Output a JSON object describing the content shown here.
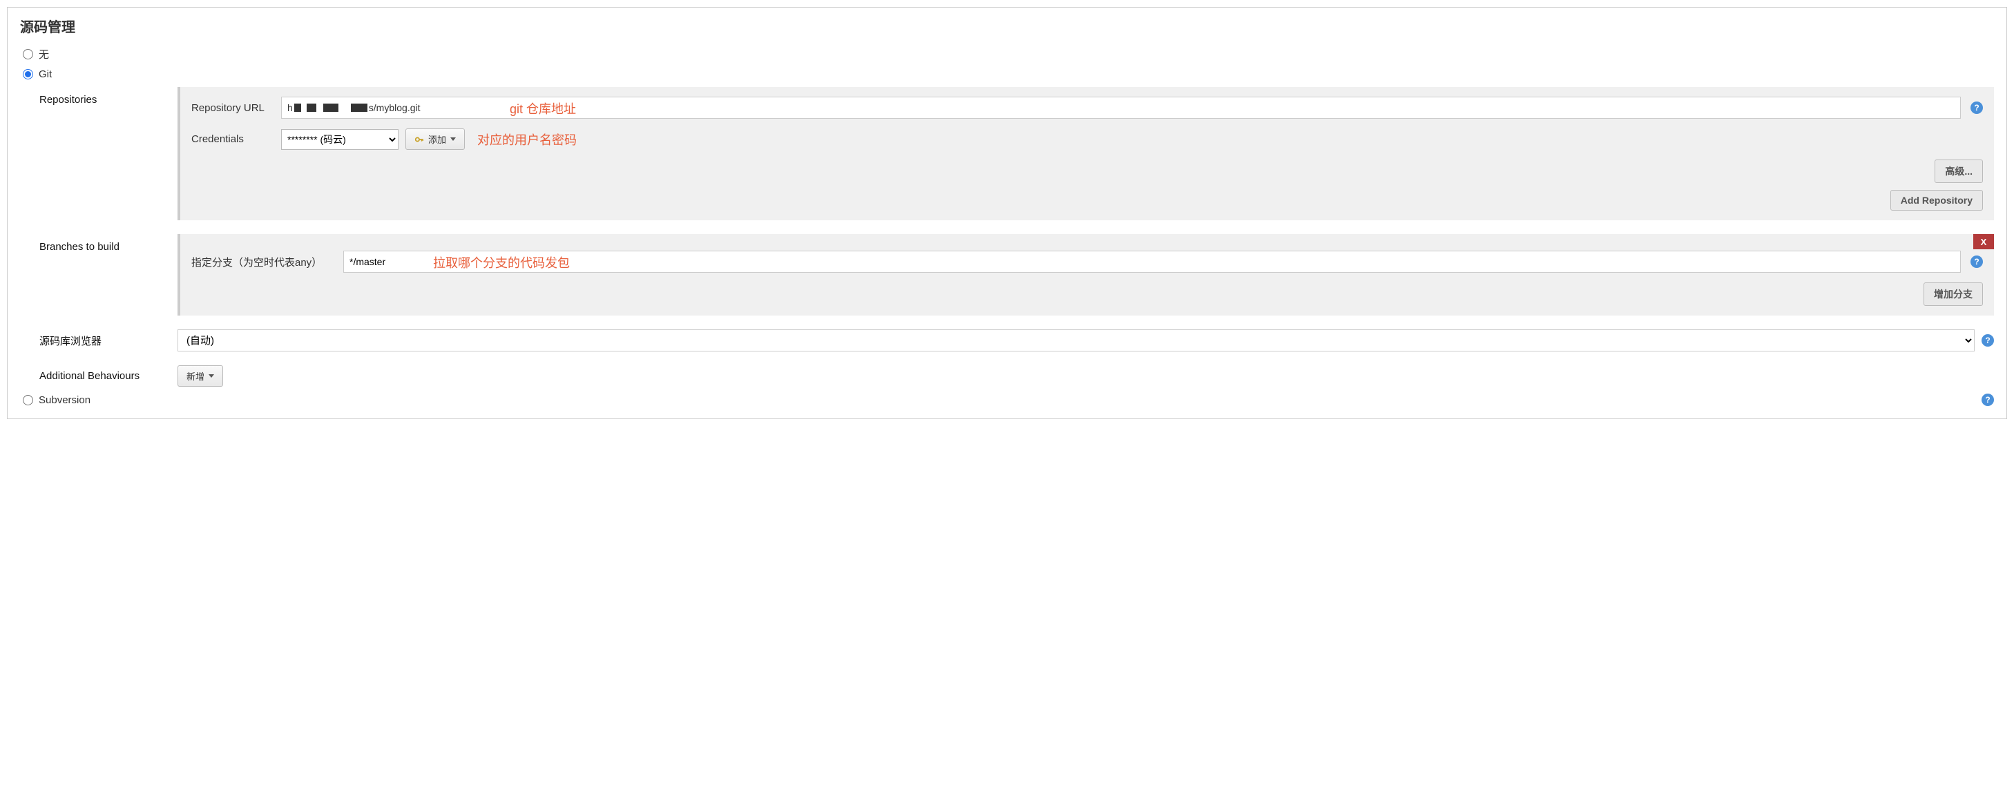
{
  "section": {
    "title": "源码管理"
  },
  "scm_options": {
    "none": {
      "label": "无",
      "selected": false
    },
    "git": {
      "label": "Git",
      "selected": true
    },
    "subversion": {
      "label": "Subversion",
      "selected": false
    }
  },
  "repositories": {
    "label": "Repositories",
    "url_label": "Repository URL",
    "url_prefix": "h",
    "url_suffix": "s/myblog.git",
    "annotation": "git 仓库地址",
    "credentials_label": "Credentials",
    "credentials_value": "******** (码云)",
    "add_button": "添加",
    "cred_annotation": "对应的用户名密码",
    "advanced_button": "高级...",
    "add_repo_button": "Add Repository"
  },
  "branches": {
    "label": "Branches to build",
    "specifier_label": "指定分支（为空时代表any）",
    "value": "*/master",
    "annotation": "拉取哪个分支的代码发包",
    "delete_x": "X",
    "add_branch_button": "增加分支"
  },
  "browser": {
    "label": "源码库浏览器",
    "value": "(自动)"
  },
  "behaviours": {
    "label": "Additional Behaviours",
    "add_button": "新增"
  },
  "help": "?"
}
